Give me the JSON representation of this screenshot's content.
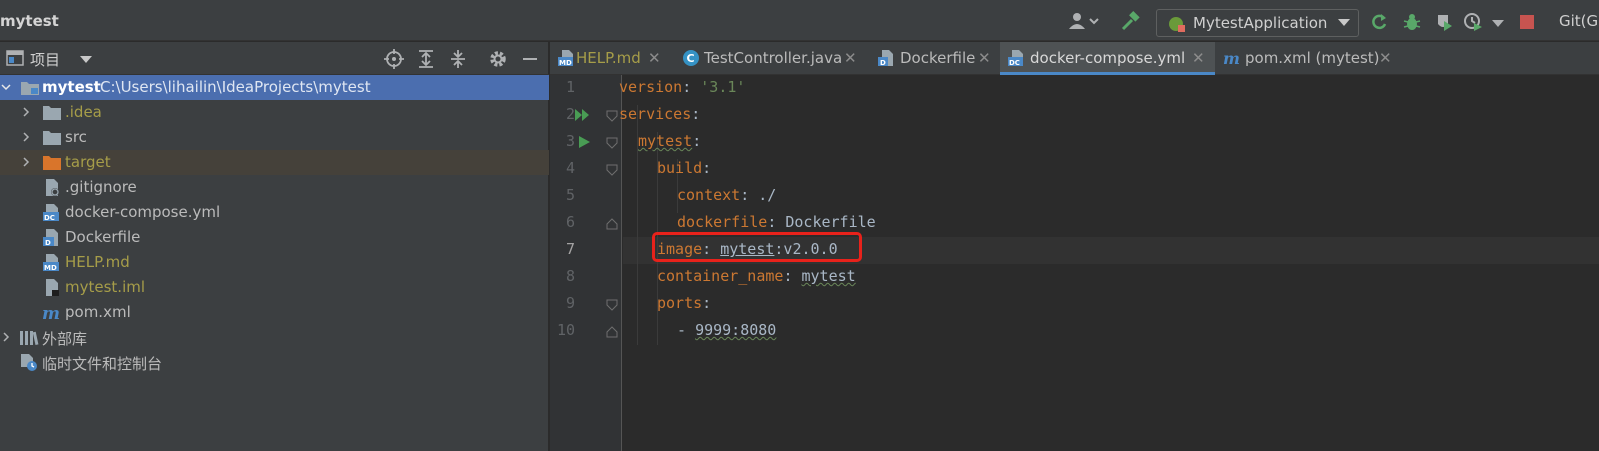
{
  "window": {
    "project_title": "mytest",
    "git_label": "Git(G)"
  },
  "run_config": {
    "label": "MytestApplication"
  },
  "project_panel": {
    "title": "项目",
    "tree": [
      {
        "label": "mytest",
        "path": "C:\\Users\\lihailin\\IdeaProjects\\mytest"
      },
      {
        "label": ".idea"
      },
      {
        "label": "src"
      },
      {
        "label": "target"
      },
      {
        "label": ".gitignore"
      },
      {
        "label": "docker-compose.yml"
      },
      {
        "label": "Dockerfile"
      },
      {
        "label": "HELP.md"
      },
      {
        "label": "mytest.iml"
      },
      {
        "label": "pom.xml"
      },
      {
        "label": "外部库"
      },
      {
        "label": "临时文件和控制台"
      }
    ]
  },
  "editor": {
    "tabs": [
      {
        "label": "HELP.md"
      },
      {
        "label": "TestController.java"
      },
      {
        "label": "Dockerfile"
      },
      {
        "label": "docker-compose.yml"
      },
      {
        "label": "pom.xml (mytest)"
      }
    ],
    "active_tab": "docker-compose.yml",
    "line_numbers": [
      "1",
      "2",
      "3",
      "4",
      "5",
      "6",
      "7",
      "8",
      "9",
      "10"
    ],
    "current_line": 7,
    "code": {
      "l1": {
        "key": "version",
        "colon": ": ",
        "value": "'3.1'"
      },
      "l2": {
        "key": "services",
        "colon": ":"
      },
      "l3": {
        "key": "mytest",
        "colon": ":"
      },
      "l4": {
        "key": "build",
        "colon": ":"
      },
      "l5": {
        "key": "context",
        "colon": ": ",
        "value": "./"
      },
      "l6": {
        "key": "dockerfile",
        "colon": ": ",
        "value": "Dockerfile"
      },
      "l7": {
        "key": "image",
        "colon": ": ",
        "value_a": "mytest",
        "value_b": ":v2.0.0"
      },
      "l8": {
        "key": "container_name",
        "colon": ": ",
        "value": "mytest"
      },
      "l9": {
        "key": "ports",
        "colon": ":"
      },
      "l10": {
        "dash": "- ",
        "value": "9999:8080"
      }
    }
  },
  "colors": {
    "selection": "#4b6eaf",
    "accent_red": "#e8221b",
    "run_green": "#499c54",
    "yaml_key": "#cc7832",
    "yaml_string": "#6a8759",
    "plain_text": "#a9b7c6"
  }
}
